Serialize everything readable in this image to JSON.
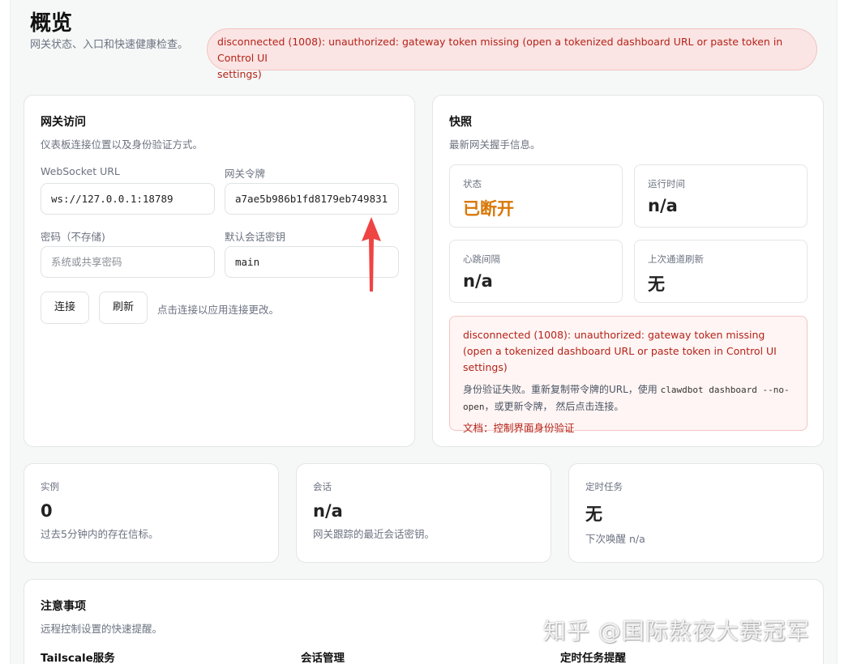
{
  "header": {
    "title": "概览",
    "subtitle": "网关状态、入口和快速健康检查。",
    "error_banner": "disconnected (1008): unauthorized: gateway token missing (open a tokenized dashboard URL or paste token in Control UI\nsettings)"
  },
  "gateway_access": {
    "title": "网关访问",
    "subtitle": "仪表板连接位置以及身份验证方式。",
    "websocket_label": "WebSocket URL",
    "websocket_value": "ws://127.0.0.1:18789",
    "token_label": "网关令牌",
    "token_value": "a7ae5b986b1fd8179eb749831",
    "password_label": "密码（不存储)",
    "password_placeholder": "系统或共享密码",
    "session_key_label": "默认会话密钥",
    "session_key_value": "main",
    "connect_button": "连接",
    "refresh_button": "刷新",
    "hint": "点击连接以应用连接更改。"
  },
  "snapshot": {
    "title": "快照",
    "subtitle": "最新网关握手信息。",
    "stats": [
      {
        "label": "状态",
        "value": "已断开"
      },
      {
        "label": "运行时间",
        "value": "n/a"
      },
      {
        "label": "心跳间隔",
        "value": "n/a"
      },
      {
        "label": "上次通道刷新",
        "value": "无"
      }
    ],
    "status_color": "#d97706",
    "error": {
      "message": "disconnected (1008): unauthorized: gateway token missing (open a tokenized dashboard URL or paste token in Control UI settings)",
      "help_before": "身份验证失败。重新复制带令牌的URL，使用 ",
      "help_code": "clawdbot dashboard --no-open",
      "help_after": "，或更新令牌， 然后点击连接。",
      "docs": "文档：控制界面身份验证"
    }
  },
  "metrics": [
    {
      "label": "实例",
      "value": "0",
      "sub": "过去5分钟内的存在信标。"
    },
    {
      "label": "会话",
      "value": "n/a",
      "sub": "网关跟踪的最近会话密钥。"
    },
    {
      "label": "定时任务",
      "value": "无",
      "sub": "下次唤醒 n/a"
    }
  ],
  "notes": {
    "title": "注意事项",
    "subtitle": "远程控制设置的快速提醒。",
    "columns": [
      "Tailscale服务",
      "会话管理",
      "定时任务提醒"
    ]
  },
  "watermark": "知乎 @国际熬夜大赛冠军",
  "colors": {
    "error": "#b42318",
    "warning": "#d97706",
    "annotation_arrow": "#ef4444"
  }
}
